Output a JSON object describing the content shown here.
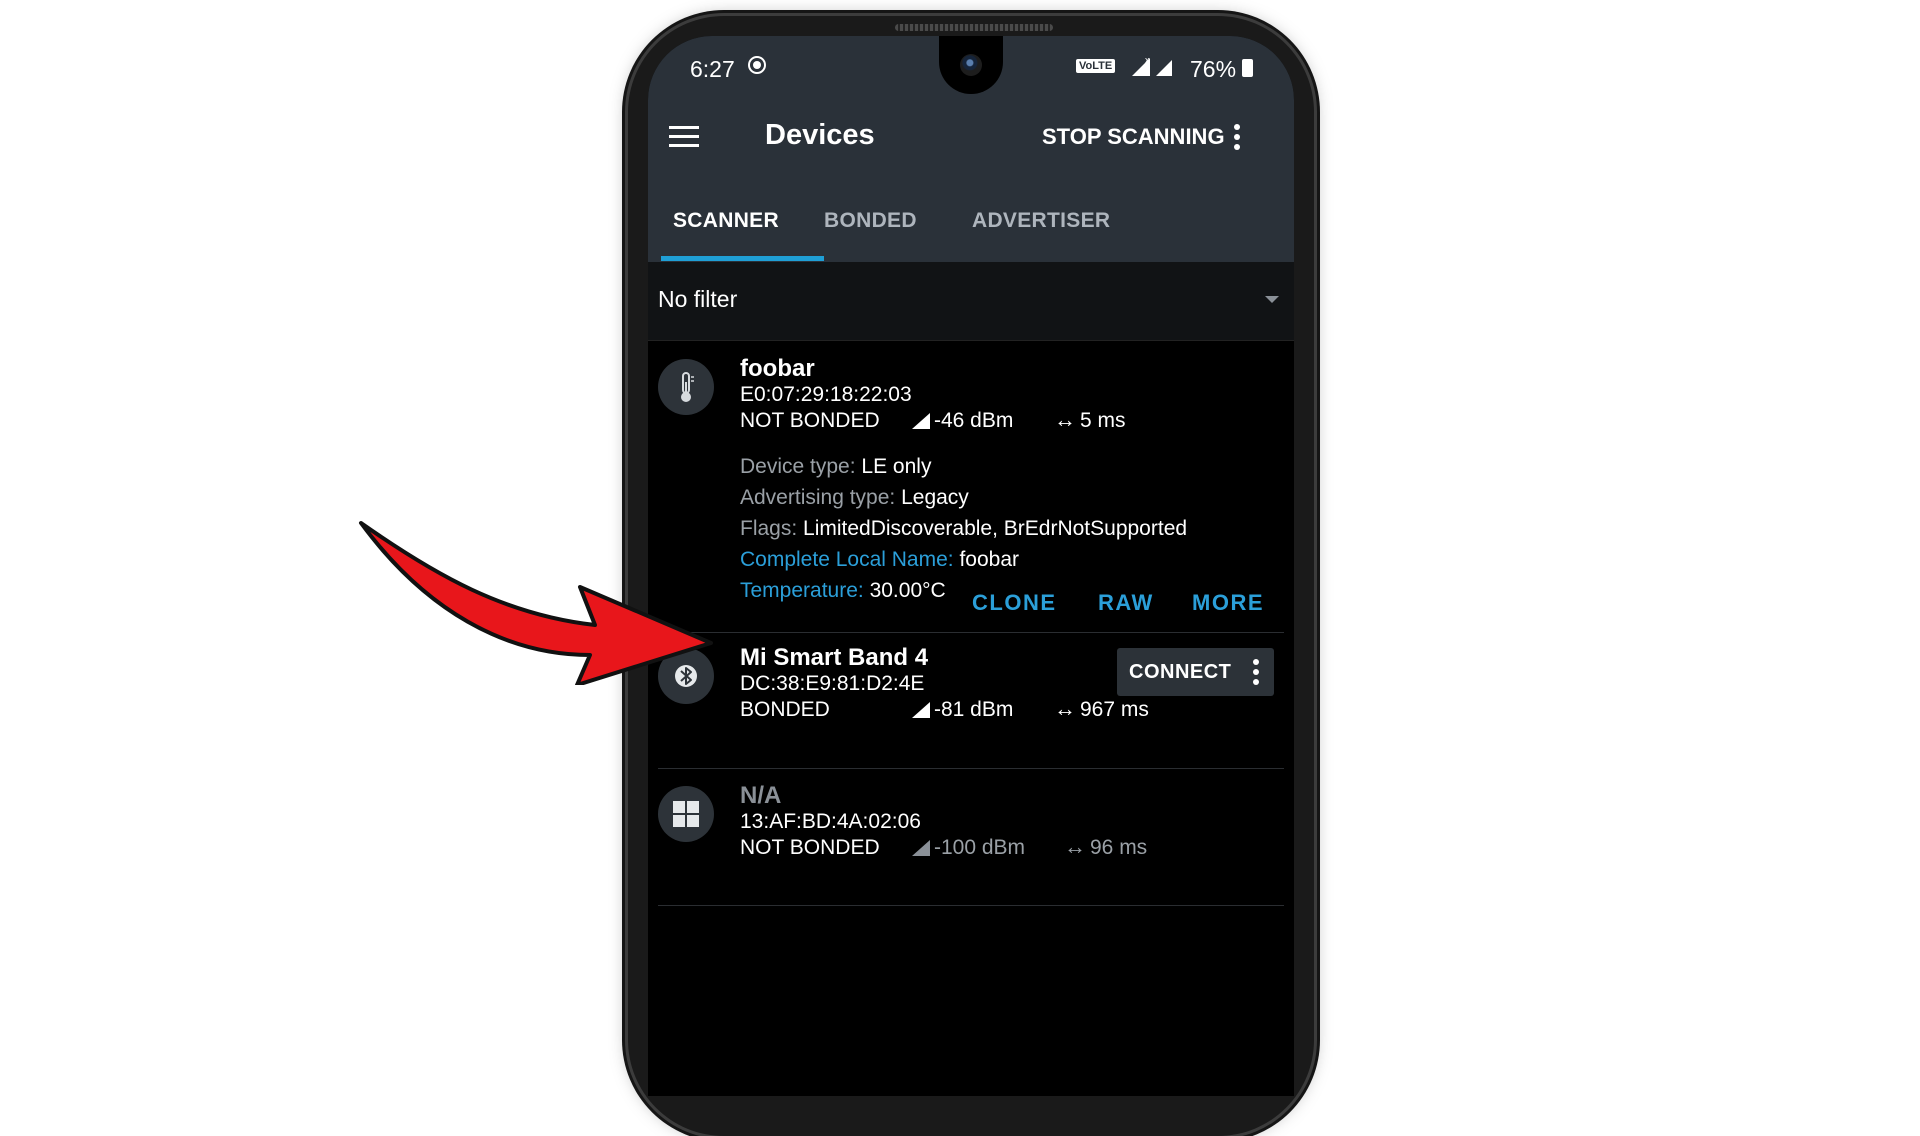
{
  "status_bar": {
    "time": "6:27",
    "volte": "VoLTE",
    "battery": "76%"
  },
  "toolbar": {
    "title": "Devices",
    "stop_scanning": "STOP SCANNING"
  },
  "tabs": [
    {
      "label": "SCANNER",
      "active": true
    },
    {
      "label": "BONDED",
      "active": false
    },
    {
      "label": "ADVERTISER",
      "active": false
    }
  ],
  "filter": {
    "label": "No filter"
  },
  "devices": [
    {
      "name": "foobar",
      "address": "E0:07:29:18:22:03",
      "bond": "NOT BONDED",
      "rssi": "-46 dBm",
      "interval": "5 ms",
      "icon": "thermometer-icon",
      "details": [
        {
          "key": "Device type:",
          "value": "LE only"
        },
        {
          "key": "Advertising type:",
          "value": "Legacy"
        },
        {
          "key": "Flags:",
          "value": "LimitedDiscoverable, BrEdrNotSupported"
        },
        {
          "key": "Complete Local Name:",
          "value": "foobar"
        },
        {
          "key": "Temperature:",
          "value": "30.00°C"
        }
      ],
      "actions": [
        "CLONE",
        "RAW",
        "MORE"
      ]
    },
    {
      "name": "Mi Smart Band 4",
      "address": "DC:38:E9:81:D2:4E",
      "bond": "BONDED",
      "rssi": "-81 dBm",
      "interval": "967 ms",
      "icon": "bluetooth-icon",
      "connect_label": "CONNECT"
    },
    {
      "name": "N/A",
      "address": "13:AF:BD:4A:02:06",
      "bond": "NOT BONDED",
      "rssi": "-100 dBm",
      "interval": "96 ms",
      "icon": "windows-icon"
    }
  ],
  "colors": {
    "toolbar_bg": "#2a3139",
    "accent": "#2b9fd9",
    "arrow": "#e8161b"
  }
}
